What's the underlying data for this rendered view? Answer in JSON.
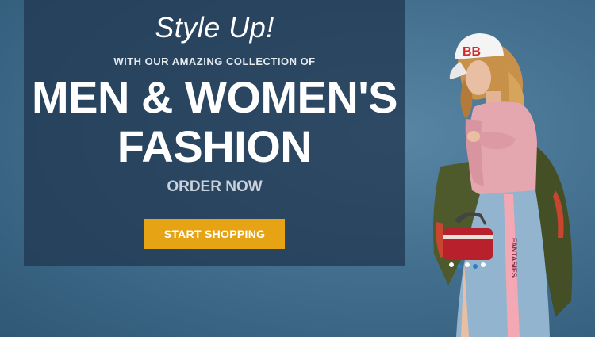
{
  "hero": {
    "tagline": "Style Up!",
    "subtitle": "WITH OUR AMAZING COLLECTION OF",
    "headline_line1": "MEN & WOMEN'S",
    "headline_line2": "FASHION",
    "order_now": "ORDER NOW",
    "cta_label": "START SHOPPING"
  },
  "model_image": {
    "cap_text": "BB",
    "skirt_text": "FANTASIES",
    "icon": "fashion-model-photo"
  },
  "colors": {
    "background": "#44708f",
    "overlay": "#213952",
    "cta": "#e6a414",
    "text": "#ffffff"
  }
}
